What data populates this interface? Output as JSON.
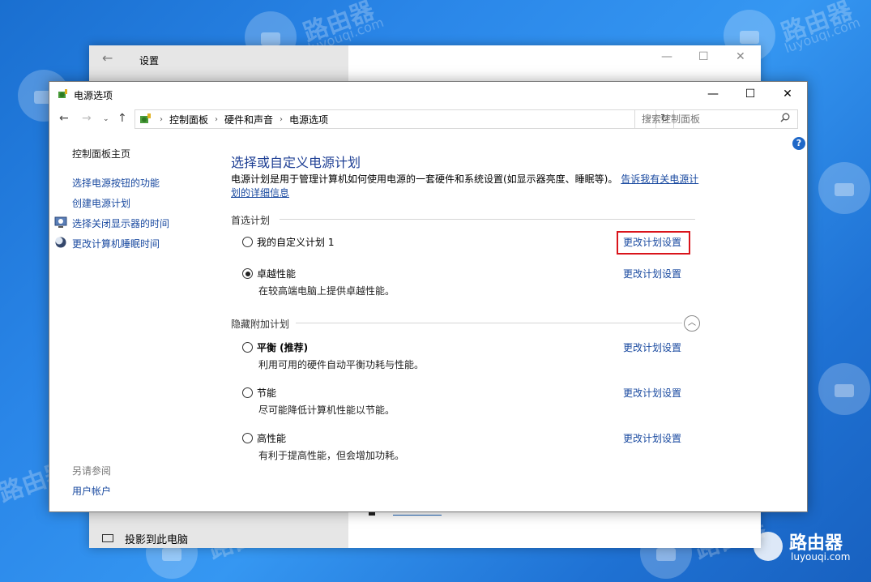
{
  "watermark": {
    "brand": "路由器",
    "domain": "luyouqi.com"
  },
  "settings_window": {
    "title": "设置",
    "bottom_item": "投影到此电脑"
  },
  "window": {
    "title": "电源选项",
    "minimize": "—",
    "maximize": "☐",
    "close": "✕"
  },
  "address": {
    "crumbs": [
      "控制面板",
      "硬件和声音",
      "电源选项"
    ],
    "search_placeholder": "搜索控制面板"
  },
  "sidebar": {
    "home": "控制面板主页",
    "items": [
      {
        "label": "选择电源按钮的功能",
        "icon": ""
      },
      {
        "label": "创建电源计划",
        "icon": ""
      },
      {
        "label": "选择关闭显示器的时间",
        "icon": "monitor-clock-icon"
      },
      {
        "label": "更改计算机睡眠时间",
        "icon": "moon-icon"
      }
    ],
    "see_also_title": "另请参阅",
    "see_also_items": [
      "用户帐户"
    ]
  },
  "main": {
    "heading": "选择或自定义电源计划",
    "description": "电源计划是用于管理计算机如何使用电源的一套硬件和系统设置(如显示器亮度、睡眠等)。",
    "description_link_1": "告诉我有关电源计",
    "description_link_2": "划的详细信息",
    "preferred_group": "首选计划",
    "hidden_group": "隐藏附加计划",
    "change_link": "更改计划设置",
    "preferred_plans": [
      {
        "name": "我的自定义计划 1",
        "desc": "",
        "selected": false,
        "bold": false
      },
      {
        "name": "卓越性能",
        "desc": "在较高端电脑上提供卓越性能。",
        "selected": true,
        "bold": false
      }
    ],
    "hidden_plans": [
      {
        "name": "平衡 (推荐)",
        "desc": "利用可用的硬件自动平衡功耗与性能。",
        "selected": false,
        "bold": true
      },
      {
        "name": "节能",
        "desc": "尽可能降低计算机性能以节能。",
        "selected": false,
        "bold": false
      },
      {
        "name": "高性能",
        "desc": "有利于提高性能，但会增加功耗。",
        "selected": false,
        "bold": false
      }
    ]
  },
  "colors": {
    "link": "#1a4aa0",
    "heading": "#1e3f94",
    "highlight_box": "#d9141b",
    "desktop": "#2a86e8"
  }
}
